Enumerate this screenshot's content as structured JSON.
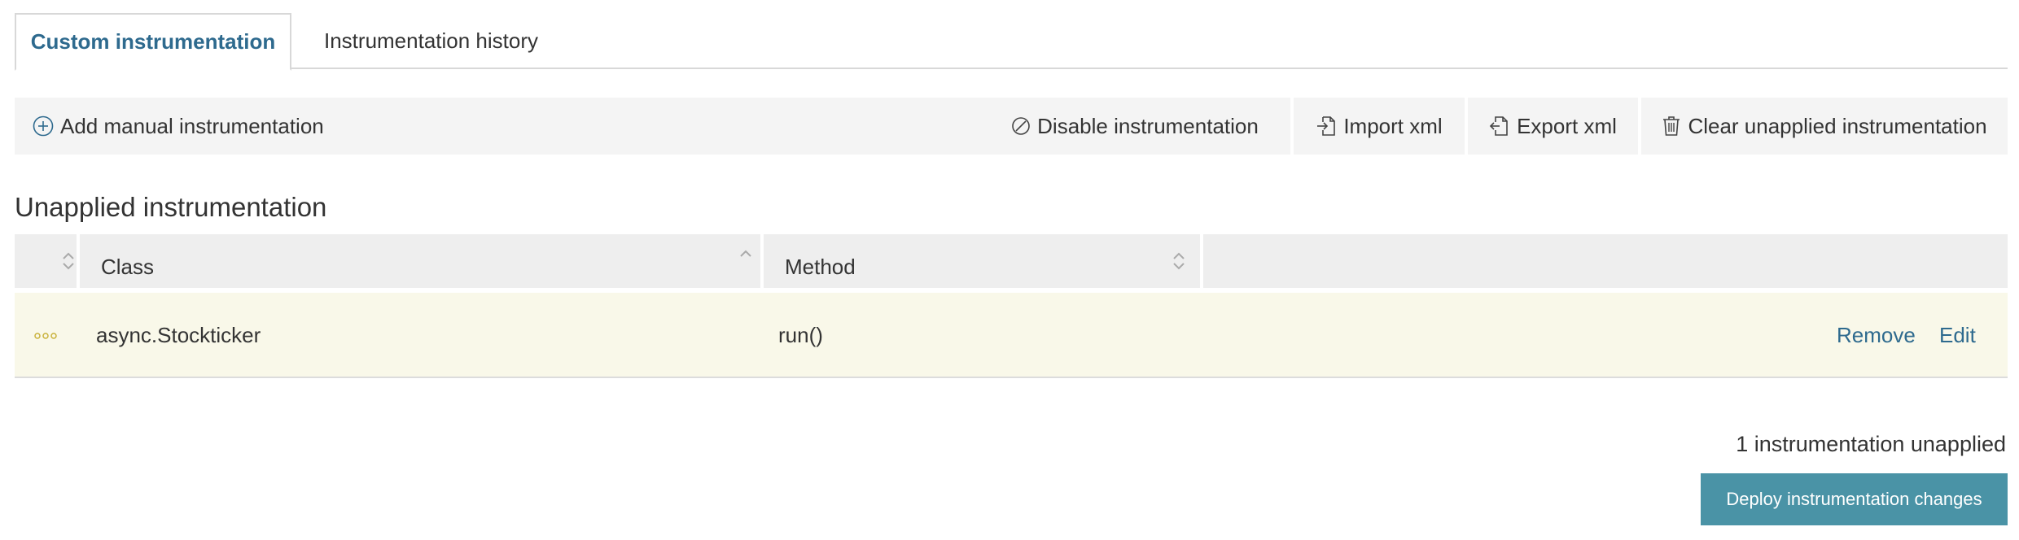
{
  "tabs": {
    "custom": "Custom instrumentation",
    "history": "Instrumentation history"
  },
  "toolbar": {
    "add": "Add manual instrumentation",
    "disable": "Disable instrumentation",
    "import": "Import xml",
    "export": "Export xml",
    "clear": "Clear unapplied instrumentation",
    "icons": [
      "plus-circle-icon",
      "disable-icon",
      "import-icon",
      "export-icon",
      "trash-icon"
    ]
  },
  "section": {
    "title": "Unapplied instrumentation"
  },
  "table": {
    "columns": [
      "Class",
      "Method"
    ],
    "rows": [
      {
        "class": "async.Stockticker",
        "method": "run()",
        "actions": [
          "Remove",
          "Edit"
        ]
      }
    ]
  },
  "footer": {
    "status": "1 instrumentation unapplied",
    "deploy": "Deploy instrumentation changes"
  },
  "colors": {
    "accent": "#2e6a8e",
    "button": "#4a93a6",
    "row_highlight": "#f9f8e9",
    "toolbar_bg": "#f4f4f4"
  }
}
